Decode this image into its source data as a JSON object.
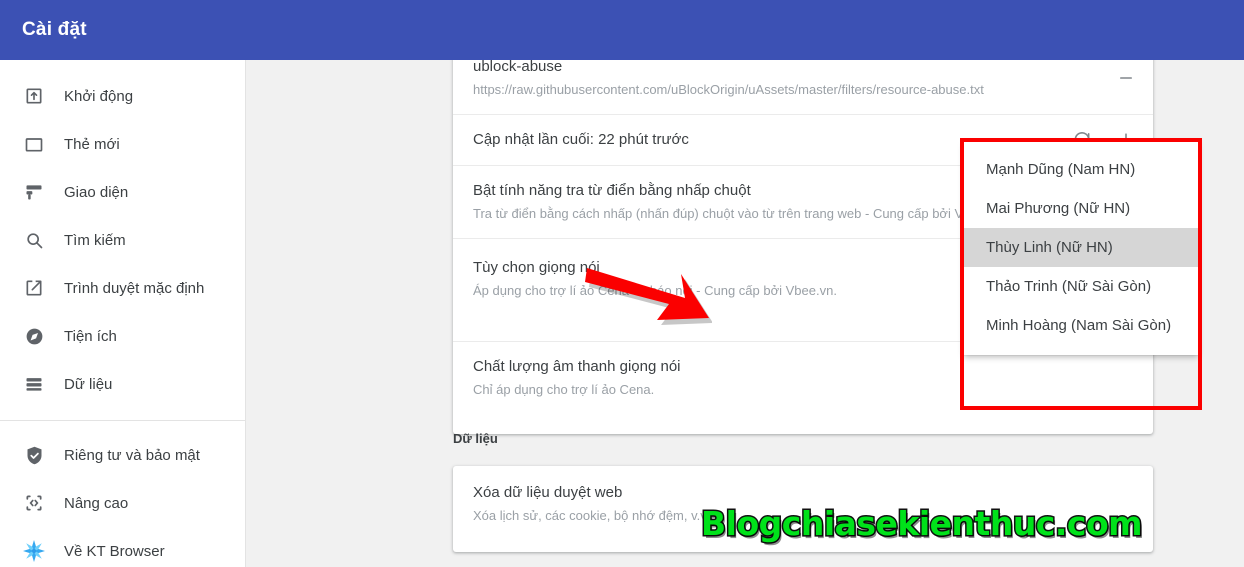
{
  "appbar": {
    "title": "Cài đặt"
  },
  "sidebar": {
    "items": [
      {
        "label": "Khởi động",
        "icon": "startup-icon"
      },
      {
        "label": "Thẻ mới",
        "icon": "new-tab-icon"
      },
      {
        "label": "Giao diện",
        "icon": "appearance-icon"
      },
      {
        "label": "Tìm kiếm",
        "icon": "search-icon"
      },
      {
        "label": "Trình duyệt mặc định",
        "icon": "default-browser-icon"
      },
      {
        "label": "Tiện ích",
        "icon": "extensions-icon"
      },
      {
        "label": "Dữ liệu",
        "icon": "data-icon"
      }
    ],
    "items2": [
      {
        "label": "Riêng tư và bảo mật",
        "icon": "shield-check-icon"
      },
      {
        "label": "Nâng cao",
        "icon": "code-brackets-icon"
      },
      {
        "label": "Về KT Browser",
        "icon": "kt-browser-logo-icon"
      }
    ]
  },
  "settings_card": {
    "rows": [
      {
        "title": "ublock-abuse",
        "sub": "https://raw.githubusercontent.com/uBlockOrigin/uAssets/master/filters/resource-abuse.txt",
        "actions": [
          "minus-icon"
        ]
      },
      {
        "title": "Cập nhật lần cuối: 22 phút trước",
        "sub": "",
        "actions": [
          "refresh-icon",
          "plus-icon"
        ]
      },
      {
        "title": "Bật tính năng tra từ điển bằng nhấp chuột",
        "sub": "Tra từ điển bằng cách nhấp (nhấn đúp) chuột vào từ trên trang web - Cung cấp bởi Vbee.vn.",
        "actions": []
      },
      {
        "title": "Tùy chọn giọng nói",
        "sub": "Áp dụng cho trợ lí ảo Cena và báo nói - Cung cấp bởi Vbee.vn.",
        "actions": []
      },
      {
        "title": "Chất lượng âm thanh giọng nói",
        "sub": "Chỉ áp dụng cho trợ lí ảo Cena.",
        "actions": []
      }
    ]
  },
  "voice_dropdown": {
    "options": [
      "Mạnh Dũng (Nam HN)",
      "Mai Phương (Nữ HN)",
      "Thùy Linh (Nữ HN)",
      "Thảo Trinh (Nữ Sài Gòn)",
      "Minh Hoàng (Nam Sài Gòn)"
    ],
    "selected": "Thùy Linh (Nữ HN)",
    "selected_index": 2
  },
  "data_section": {
    "heading": "Dữ liệu",
    "row": {
      "title": "Xóa dữ liệu duyệt web",
      "sub": "Xóa lịch sử, các cookie, bộ nhớ đệm, v.v."
    }
  },
  "watermark": {
    "text": "Blogchiasekienthuc.com"
  },
  "annotations": {
    "arrow_color": "#fb0000",
    "box_color": "#fb0000"
  },
  "colors": {
    "appbar": "#3c51b4",
    "page_bg": "#f1f1f1",
    "card_bg": "#ffffff",
    "selected_item_bg": "#d6d6d6",
    "watermark_fill": "#00e21a"
  }
}
